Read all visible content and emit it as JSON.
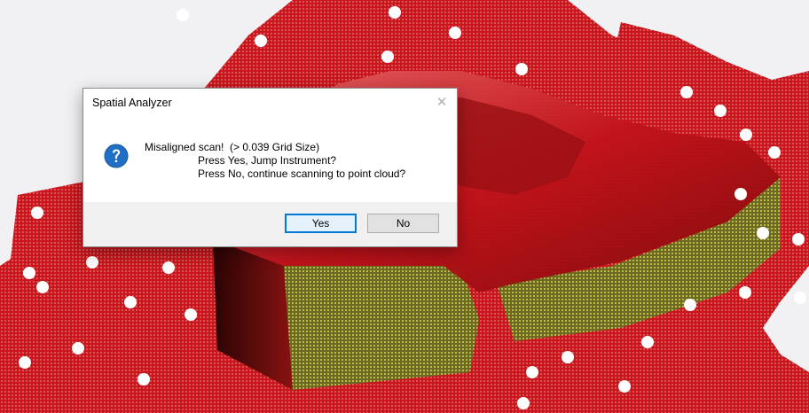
{
  "dialog": {
    "title": "Spatial Analyzer",
    "close_glyph": "✕",
    "icon": "question-icon",
    "message_lines": [
      "Misaligned scan!  (> 0.039 Grid Size)",
      "Press Yes, Jump Instrument?",
      "Press No, continue scanning to point cloud?"
    ],
    "buttons": {
      "yes": "Yes",
      "no": "No"
    }
  },
  "colors": {
    "scan_red": "#c8161c",
    "scan_dark": "#5a0808",
    "scan_yellow": "#b4ad3a",
    "background": "#f1f1f3",
    "accent": "#0078d7"
  }
}
